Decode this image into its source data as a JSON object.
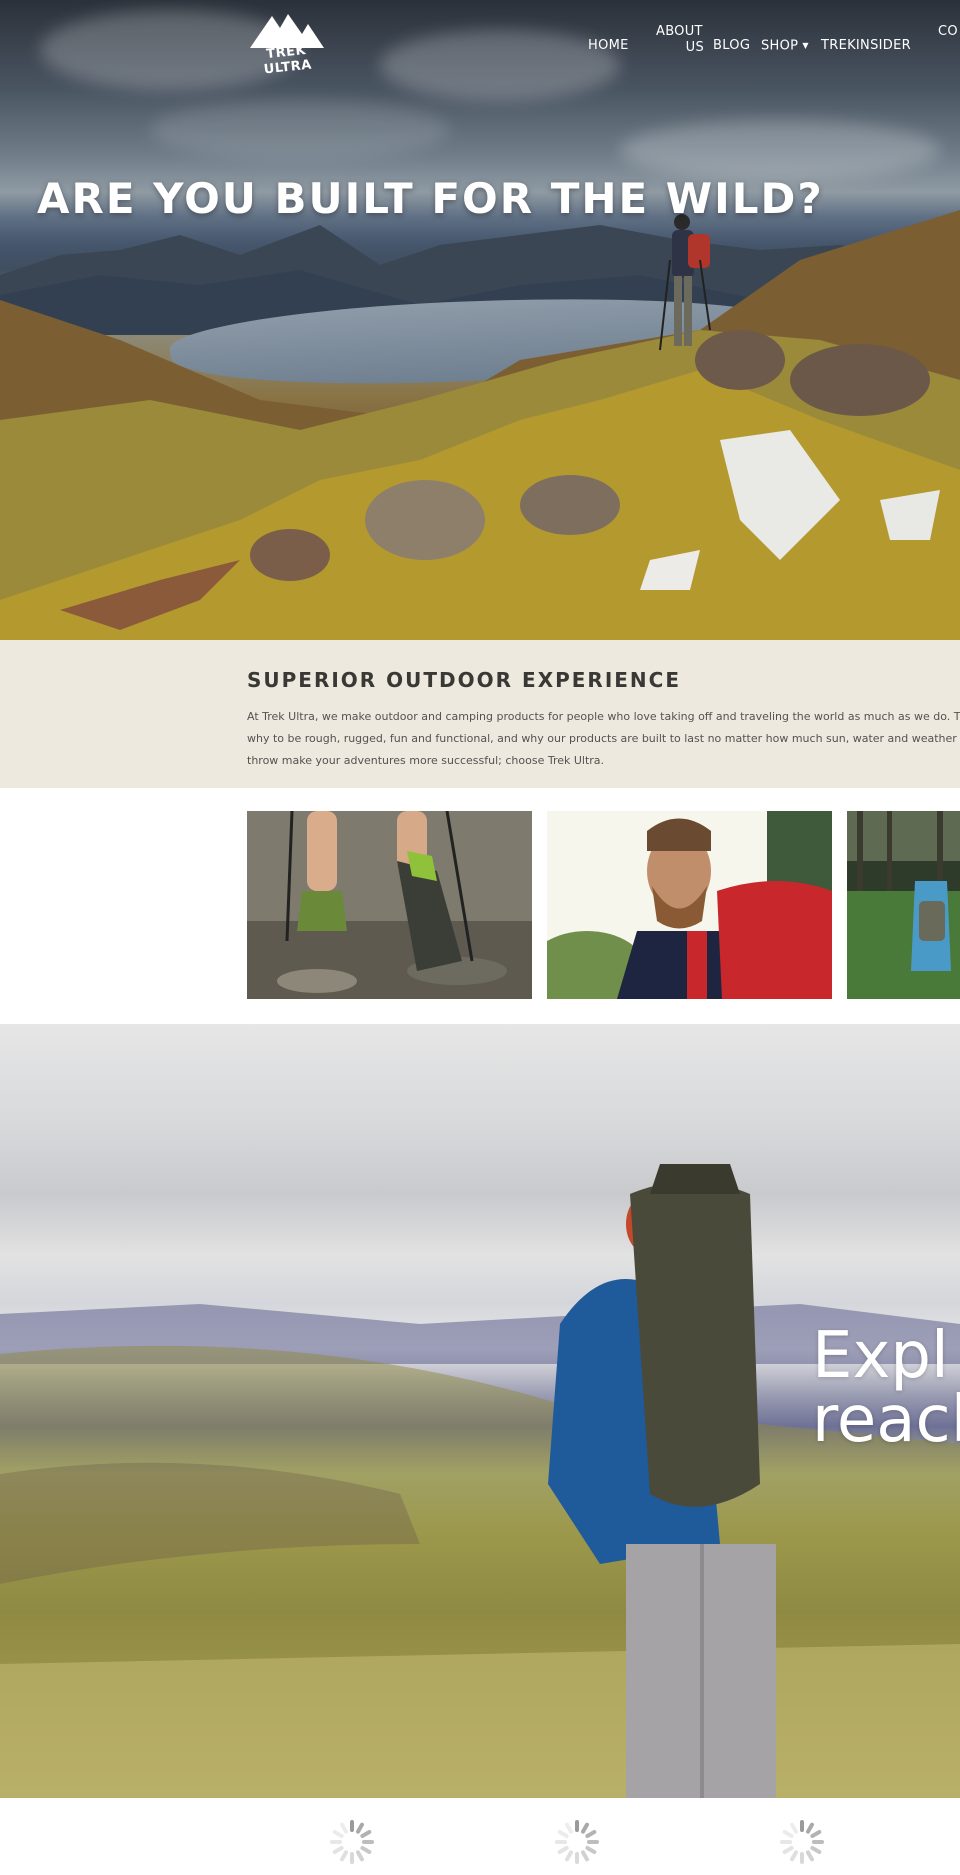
{
  "brand": {
    "logo_text": "TREK ULTRA"
  },
  "nav": {
    "items": [
      {
        "label": "HOME"
      },
      {
        "label_line1": "ABOUT",
        "label_line2": "US"
      },
      {
        "label": "BLOG"
      },
      {
        "label": "SHOP",
        "caret": "▼"
      },
      {
        "label": "TREKINSIDER"
      },
      {
        "label": "CO"
      }
    ]
  },
  "hero": {
    "title": "ARE YOU BUILT FOR THE WILD?"
  },
  "intro": {
    "title": "SUPERIOR OUTDOOR EXPERIENCE",
    "text": "At Trek Ultra, we make outdoor and camping products for people who love taking off and traveling the world as much as we do. That’s why to be rough, rugged, fun and functional, and why our products are built to last no matter how much sun, water and weather you can throw make your adventures more successful; choose Trek Ultra."
  },
  "gallery": {
    "images": [
      {
        "icon": "hiking-boots-photo"
      },
      {
        "icon": "bearded-backpacker-photo"
      },
      {
        "icon": "forest-hikers-photo"
      }
    ]
  },
  "banner": {
    "line1": "Expl",
    "line2": "reacl"
  },
  "loaders": {
    "count": 3,
    "icon": "loading-spinner-icon"
  },
  "colors": {
    "intro_bg": "#ede9df",
    "heading": "#3a3835",
    "body_text": "#555250",
    "white": "#ffffff"
  }
}
